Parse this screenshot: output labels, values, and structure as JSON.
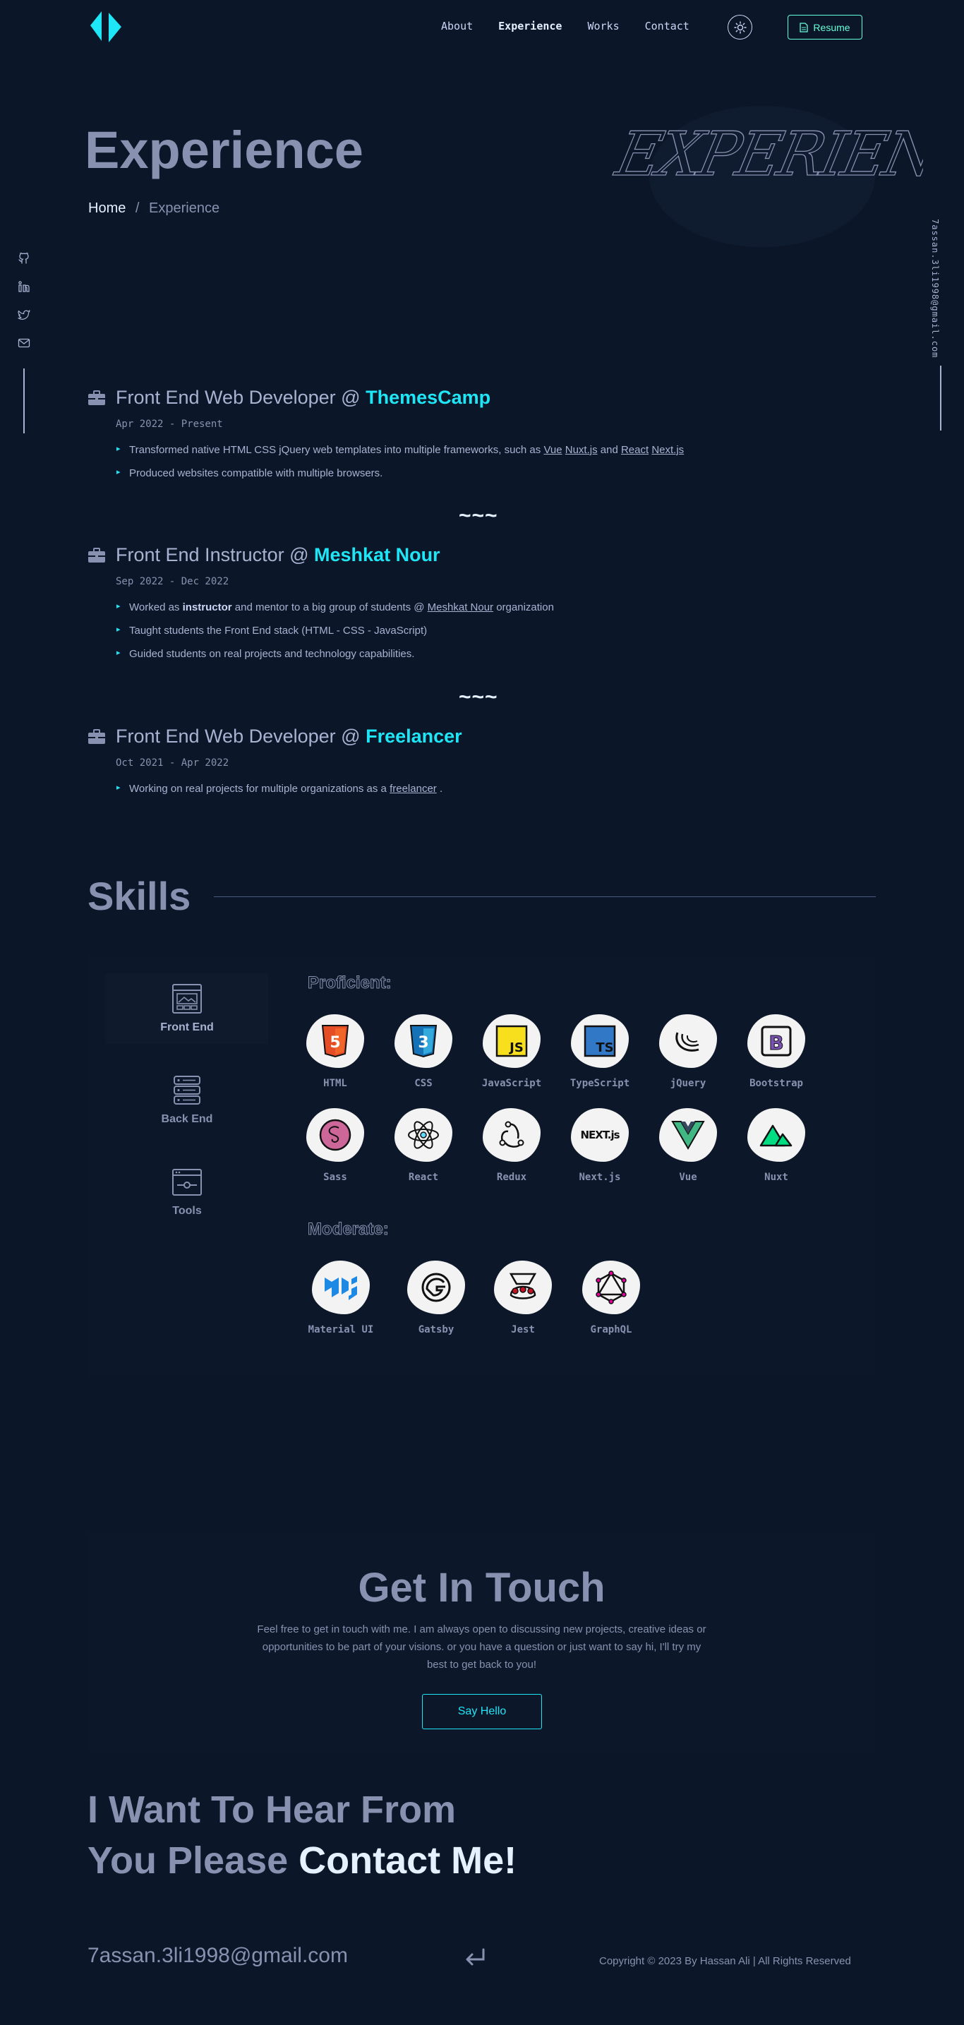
{
  "nav": {
    "links": [
      "About",
      "Experience",
      "Works",
      "Contact"
    ],
    "active": "Experience",
    "resume_label": "Resume"
  },
  "icons": {
    "logo": "logo-icon",
    "theme": "sun-icon",
    "resume": "document-icon",
    "socials": [
      "github-icon",
      "linkedin-icon",
      "twitter-icon",
      "mail-icon"
    ],
    "job": "briefcase-icon",
    "enter": "enter-arrow-icon"
  },
  "side_email": "7assan.3li1998@gmail.com",
  "hero": {
    "title": "Experience",
    "breadcrumb_home": "Home",
    "breadcrumb_sep": "/",
    "breadcrumb_current": "Experience",
    "script_word": "EXPERIENCE"
  },
  "jobs": [
    {
      "role": "Front End Web Developer @",
      "company": "ThemesCamp",
      "date": "Apr 2022 - Present",
      "points": [
        {
          "pre": "Transformed native HTML CSS jQuery web templates into multiple frameworks, such as ",
          "links": [
            "Vue",
            "Nuxt.js"
          ],
          "mid": " and ",
          "links2": [
            "React",
            "Next.js"
          ]
        },
        {
          "text": "Produced websites compatible with multiple browsers."
        }
      ]
    },
    {
      "role": "Front End Instructor @",
      "company": "Meshkat Nour",
      "date": "Sep 2022 - Dec 2022",
      "points": [
        {
          "pre": "Worked as ",
          "bold": "instructor",
          "mid": " and mentor to a big group of students @ ",
          "link": "Meshkat Nour",
          "post": " organization"
        },
        {
          "text": "Taught students the Front End stack (HTML - CSS - JavaScript)"
        },
        {
          "text": "Guided students on real projects and technology capabilities."
        }
      ]
    },
    {
      "role": "Front End Web Developer @",
      "company": "Freelancer",
      "date": "Oct 2021 - Apr 2022",
      "points": [
        {
          "pre": "Working on real projects for multiple organizations as a ",
          "link": "freelancer",
          "post": " ."
        }
      ]
    }
  ],
  "separator": "~~~",
  "skills": {
    "title": "Skills",
    "categories": [
      {
        "label": "Front End",
        "icon": "frontend-window-icon"
      },
      {
        "label": "Back End",
        "icon": "server-stack-icon"
      },
      {
        "label": "Tools",
        "icon": "tools-window-icon"
      }
    ],
    "proficient_label": "Proficient:",
    "moderate_label": "Moderate:",
    "proficient": [
      "HTML",
      "CSS",
      "JavaScript",
      "TypeScript",
      "jQuery",
      "Bootstrap",
      "Sass",
      "React",
      "Redux",
      "Next.js",
      "Vue",
      "Nuxt"
    ],
    "moderate": [
      "Material UI",
      "Gatsby",
      "Jest",
      "GraphQL"
    ]
  },
  "contact": {
    "title": "Get In Touch",
    "text": "Feel free to get in touch with me. I am always open to discussing new projects, creative ideas or opportunities to be part of your visions. or you have a question or just want to say hi, I'll try my best to get back to you!",
    "button": "Say Hello"
  },
  "hear": {
    "line1": "I Want To Hear From",
    "line2": "You Please",
    "highlight": "Contact Me!"
  },
  "footer": {
    "email": "7assan.3li1998@gmail.com",
    "copyright": "Copyright © 2023 By Hassan Ali | All Rights Reserved"
  },
  "colors": {
    "background": "#0b1628",
    "accent": "#1ee6f6",
    "text": "#8892b0",
    "heading_light": "#e6f1ff"
  }
}
